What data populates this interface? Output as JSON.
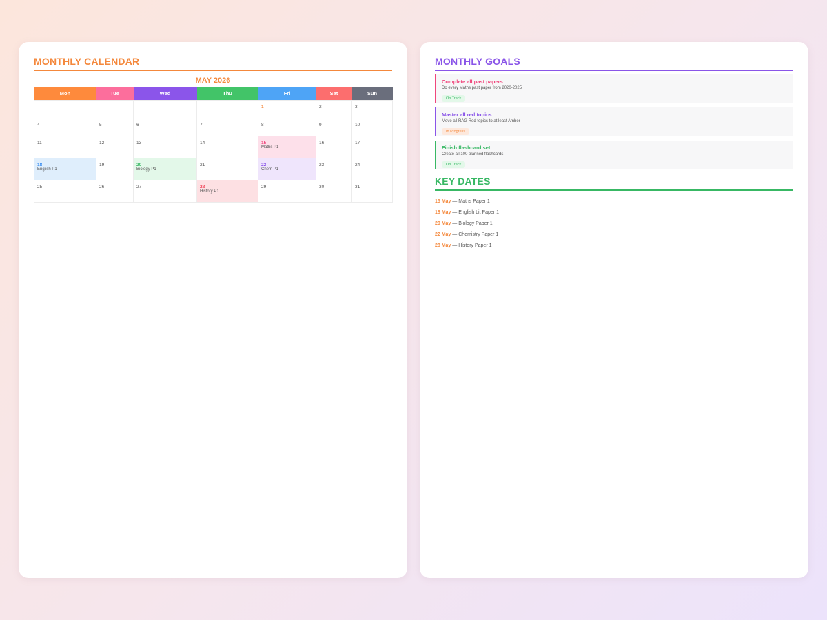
{
  "calendar": {
    "section_title": "MONTHLY CALENDAR",
    "month": "MAY 2026",
    "weekdays": [
      {
        "label": "Mon",
        "color": "#fe8a3c"
      },
      {
        "label": "Tue",
        "color": "#fc6e9c"
      },
      {
        "label": "Wed",
        "color": "#8b55ea"
      },
      {
        "label": "Thu",
        "color": "#42c468"
      },
      {
        "label": "Fri",
        "color": "#4ea4f6"
      },
      {
        "label": "Sat",
        "color": "#fc6e6e"
      },
      {
        "label": "Sun",
        "color": "#6a6e7c"
      }
    ],
    "weeks": [
      [
        {
          "day": "",
          "event": ""
        },
        {
          "day": "",
          "event": ""
        },
        {
          "day": "",
          "event": ""
        },
        {
          "day": "",
          "event": ""
        },
        {
          "day": "1",
          "event": "",
          "text_color": "#f4883c"
        },
        {
          "day": "2",
          "event": ""
        },
        {
          "day": "3",
          "event": ""
        }
      ],
      [
        {
          "day": "4",
          "event": ""
        },
        {
          "day": "5",
          "event": ""
        },
        {
          "day": "6",
          "event": ""
        },
        {
          "day": "7",
          "event": ""
        },
        {
          "day": "8",
          "event": ""
        },
        {
          "day": "9",
          "event": ""
        },
        {
          "day": "10",
          "event": ""
        }
      ],
      [
        {
          "day": "11",
          "event": ""
        },
        {
          "day": "12",
          "event": ""
        },
        {
          "day": "13",
          "event": ""
        },
        {
          "day": "14",
          "event": ""
        },
        {
          "day": "15",
          "event": "Maths P1",
          "bg": "#fde0ea",
          "text_color": "#f0467c"
        },
        {
          "day": "16",
          "event": ""
        },
        {
          "day": "17",
          "event": ""
        }
      ],
      [
        {
          "day": "18",
          "event": "English P1",
          "bg": "#dfeefc",
          "text_color": "#3b8ef0"
        },
        {
          "day": "19",
          "event": ""
        },
        {
          "day": "20",
          "event": "Biology P1",
          "bg": "#e3f8e9",
          "text_color": "#38b864"
        },
        {
          "day": "21",
          "event": ""
        },
        {
          "day": "22",
          "event": "Chem P1",
          "bg": "#efe5fc",
          "text_color": "#8a55e8"
        },
        {
          "day": "23",
          "event": ""
        },
        {
          "day": "24",
          "event": ""
        }
      ],
      [
        {
          "day": "25",
          "event": ""
        },
        {
          "day": "26",
          "event": ""
        },
        {
          "day": "27",
          "event": ""
        },
        {
          "day": "28",
          "event": "History P1",
          "bg": "#fde0e3",
          "text_color": "#f0465a"
        },
        {
          "day": "29",
          "event": ""
        },
        {
          "day": "30",
          "event": ""
        },
        {
          "day": "31",
          "event": ""
        }
      ]
    ]
  },
  "goals": {
    "section_title": "MONTHLY GOALS",
    "items": [
      {
        "title": "Complete all past papers",
        "description": "Do every Maths past paper from 2020-2025",
        "status": "On Track",
        "accent": "#f0467c",
        "badge_bg": "#e3f8e9",
        "badge_color": "#38b864"
      },
      {
        "title": "Master all red topics",
        "description": "Move all RAG Red topics to at least Amber",
        "status": "In Progress",
        "accent": "#8a55e8",
        "badge_bg": "#fde8dc",
        "badge_color": "#f4883c"
      },
      {
        "title": "Finish flashcard set",
        "description": "Create all 100 planned flashcards",
        "status": "On Track",
        "accent": "#38b864",
        "badge_bg": "#e3f8e9",
        "badge_color": "#38b864"
      }
    ]
  },
  "key_dates": {
    "section_title": "KEY DATES",
    "separator": "—",
    "items": [
      {
        "date": "15 May",
        "label": "Maths Paper 1"
      },
      {
        "date": "18 May",
        "label": "English Lit Paper 1"
      },
      {
        "date": "20 May",
        "label": "Biology Paper 1"
      },
      {
        "date": "22 May",
        "label": "Chemistry Paper 1"
      },
      {
        "date": "28 May",
        "label": "History Paper 1"
      }
    ]
  }
}
